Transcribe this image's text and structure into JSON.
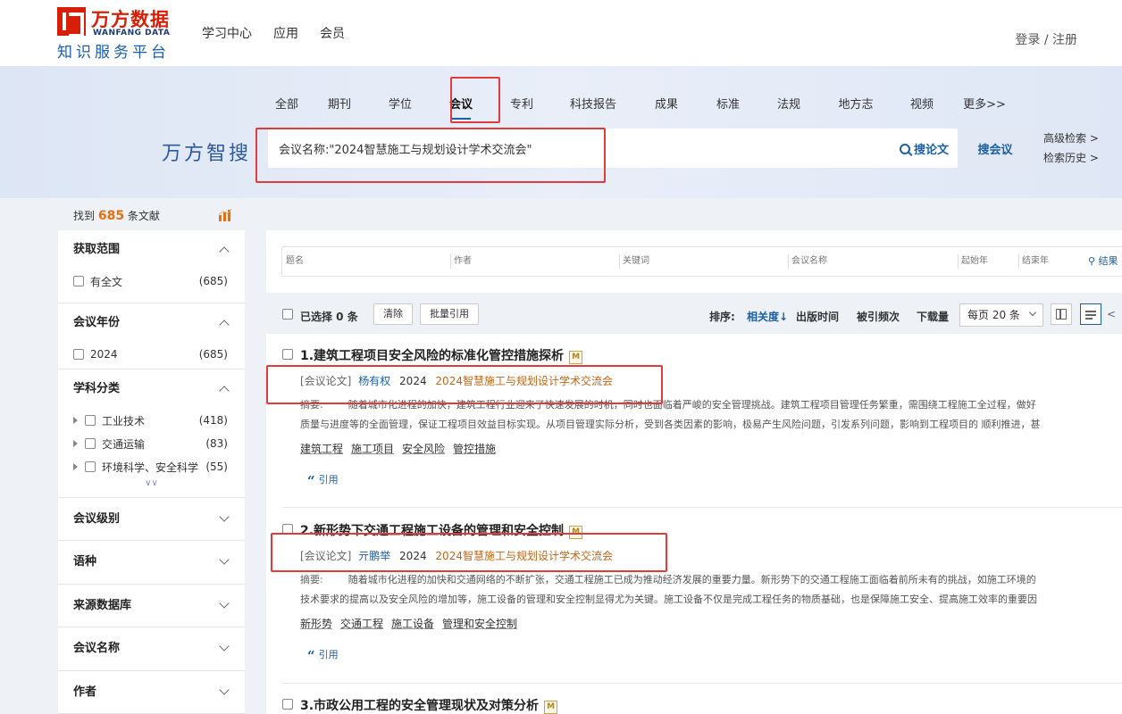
{
  "header": {
    "logo_cn": "万方数据",
    "logo_en": "WANFANG DATA",
    "logo_sub": "知识服务平台",
    "nav": [
      "学习中心",
      "应用",
      "会员"
    ],
    "login": "登录 / 注册"
  },
  "search": {
    "brand": "万方智搜",
    "categories": [
      {
        "label": "全部",
        "active": false
      },
      {
        "label": "期刊",
        "active": false
      },
      {
        "label": "学位",
        "active": false
      },
      {
        "label": "会议",
        "active": true
      },
      {
        "label": "专利",
        "active": false
      },
      {
        "label": "科技报告",
        "active": false
      },
      {
        "label": "成果",
        "active": false
      },
      {
        "label": "标准",
        "active": false
      },
      {
        "label": "法规",
        "active": false
      },
      {
        "label": "地方志",
        "active": false
      },
      {
        "label": "视频",
        "active": false
      },
      {
        "label": "更多>>",
        "active": false
      }
    ],
    "query": "会议名称:\"2024智慧施工与规划设计学术交流会\"",
    "search_in_results": "搜论文",
    "search_button": "搜会议",
    "advanced": "高级检索 >",
    "history": "检索历史 >"
  },
  "summary": {
    "prefix": "找到",
    "count": "685",
    "suffix": "条文献"
  },
  "sidebar": {
    "sections": [
      {
        "title": "获取范围",
        "expanded": true,
        "items": [
          {
            "label": "有全文",
            "count": "(685)"
          }
        ]
      },
      {
        "title": "会议年份",
        "expanded": true,
        "items": [
          {
            "label": "2024",
            "count": "(685)"
          }
        ]
      },
      {
        "title": "学科分类",
        "expanded": true,
        "items": [
          {
            "label": "工业技术",
            "count": "(418)"
          },
          {
            "label": "交通运输",
            "count": "(83)"
          },
          {
            "label": "环境科学、安全科学",
            "count": "(55)"
          }
        ]
      },
      {
        "title": "会议级别",
        "expanded": false
      },
      {
        "title": "语种",
        "expanded": false
      },
      {
        "title": "来源数据库",
        "expanded": false
      },
      {
        "title": "会议名称",
        "expanded": false
      },
      {
        "title": "作者",
        "expanded": false
      }
    ]
  },
  "filters": {
    "fields": [
      "题名",
      "作者",
      "关键词",
      "会议名称",
      "起始年",
      "结束年"
    ],
    "search": "结果"
  },
  "toolbar": {
    "selected": "已选择 0 条",
    "clear": "清除",
    "batch_cite": "批量引用",
    "sort_label": "排序:",
    "sort_options": [
      {
        "label": "相关度↓",
        "active": true
      },
      {
        "label": "出版时间",
        "active": false
      },
      {
        "label": "被引频次",
        "active": false
      },
      {
        "label": "下载量",
        "active": false
      }
    ],
    "per_page": "每页 20 条",
    "page_prev": "<"
  },
  "results": [
    {
      "title": "1.建筑工程项目安全风险的标准化管控措施探析",
      "badge": "M",
      "type": "[会议论文]",
      "author": "杨有权",
      "year": "2024",
      "conference": "2024智慧施工与规划设计学术交流会",
      "abstract_label": "摘要:",
      "abstract_line1": "随着城市化进程的加快，建筑工程行业迎来了快速发展的时机，同时也面临着严峻的安全管理挑战。建筑工程项目管理任务繁重，需围绕工程施工全过程，做好",
      "abstract_line2": "质量与进度等的全面管理，保证工程项目效益目标实现。从项目管理实际分析，受到各类因素的影响，极易产生风险问题，引发系列问题，影响到工程项目的 顺利推进，甚",
      "keywords": [
        "建筑工程",
        "施工项目",
        "安全风险",
        "管控措施"
      ],
      "cite": "引用"
    },
    {
      "title": "2.新形势下交通工程施工设备的管理和安全控制",
      "badge": "M",
      "type": "[会议论文]",
      "author": "亓鹏举",
      "year": "2024",
      "conference": "2024智慧施工与规划设计学术交流会",
      "abstract_label": "摘要:",
      "abstract_line1": "随着城市化进程的加快和交通网络的不断扩张，交通工程施工已成为推动经济发展的重要力量。新形势下的交通工程施工面临着前所未有的挑战，如施工环境的",
      "abstract_line2": "技术要求的提高以及安全风险的增加等，施工设备的管理和安全控制显得尤为关键。施工设备不仅是完成工程任务的物质基础，也是保障施工安全、提高施工效率的重要因",
      "keywords": [
        "新形势",
        "交通工程",
        "施工设备",
        "管理和安全控制"
      ],
      "cite": "引用"
    },
    {
      "title": "3.市政公用工程的安全管理现状及对策分析",
      "badge": "M"
    }
  ]
}
